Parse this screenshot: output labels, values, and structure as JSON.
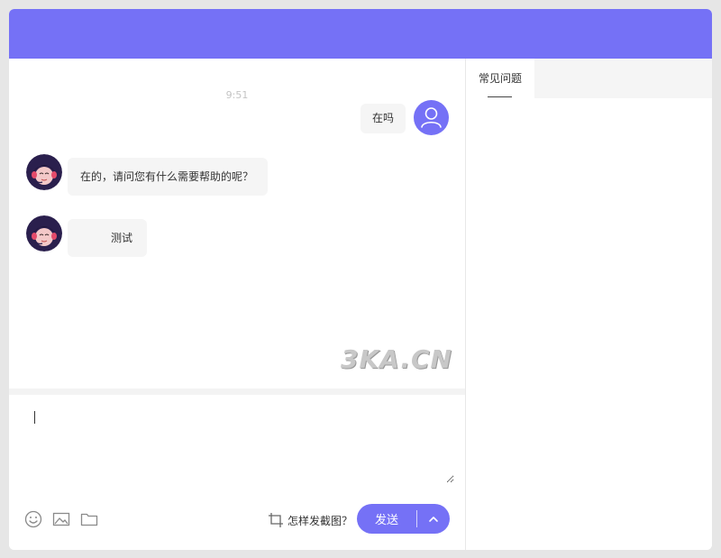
{
  "chat": {
    "timestamp": "9:51",
    "messages": [
      {
        "from": "user",
        "text": "在吗"
      },
      {
        "from": "agent",
        "text": "在的，请问您有什么需要帮助的呢？"
      },
      {
        "from": "agent",
        "text": "测试"
      }
    ]
  },
  "watermark": "3KA.CN",
  "composer": {
    "value": "",
    "screenshot_help": "怎样发截图？",
    "send_label": "发送",
    "tools": [
      "emoji-icon",
      "image-icon",
      "folder-icon"
    ]
  },
  "side_panel": {
    "tabs": [
      {
        "label": "常见问题",
        "active": true
      }
    ]
  },
  "colors": {
    "accent": "#7571f6",
    "bubble_bg": "#f5f5f5",
    "page_bg": "#e6e6e6"
  }
}
